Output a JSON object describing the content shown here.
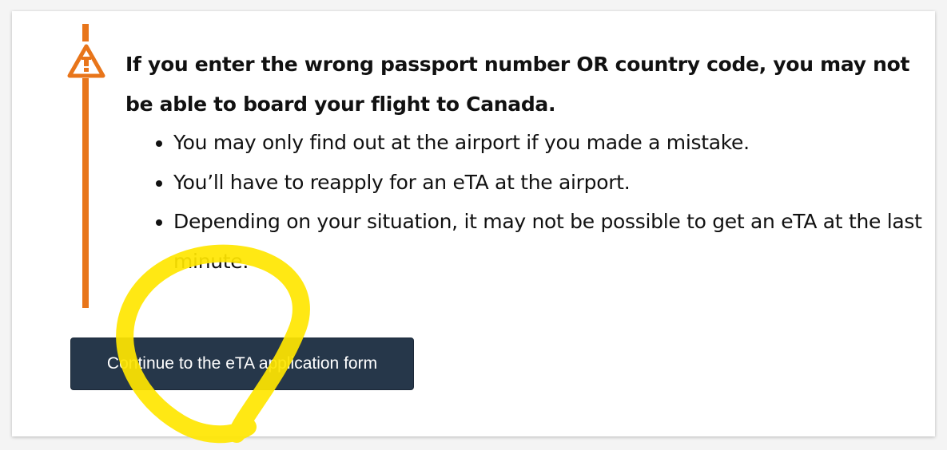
{
  "alert": {
    "icon": "warning-triangle-icon",
    "accent_color": "#e8751a",
    "heading": "If you enter the wrong passport number OR country code, you may not be able to board your flight to Canada.",
    "bullets": [
      "You may only find out at the airport if you made a mistake.",
      "You’ll have to reapply for an eTA at the airport.",
      "Depending on your situation, it may not be possible to get an eTA at the last minute."
    ]
  },
  "button": {
    "label": "Continue to the eTA application form",
    "background": "#26374a"
  },
  "annotation": {
    "color": "#ffe600"
  }
}
